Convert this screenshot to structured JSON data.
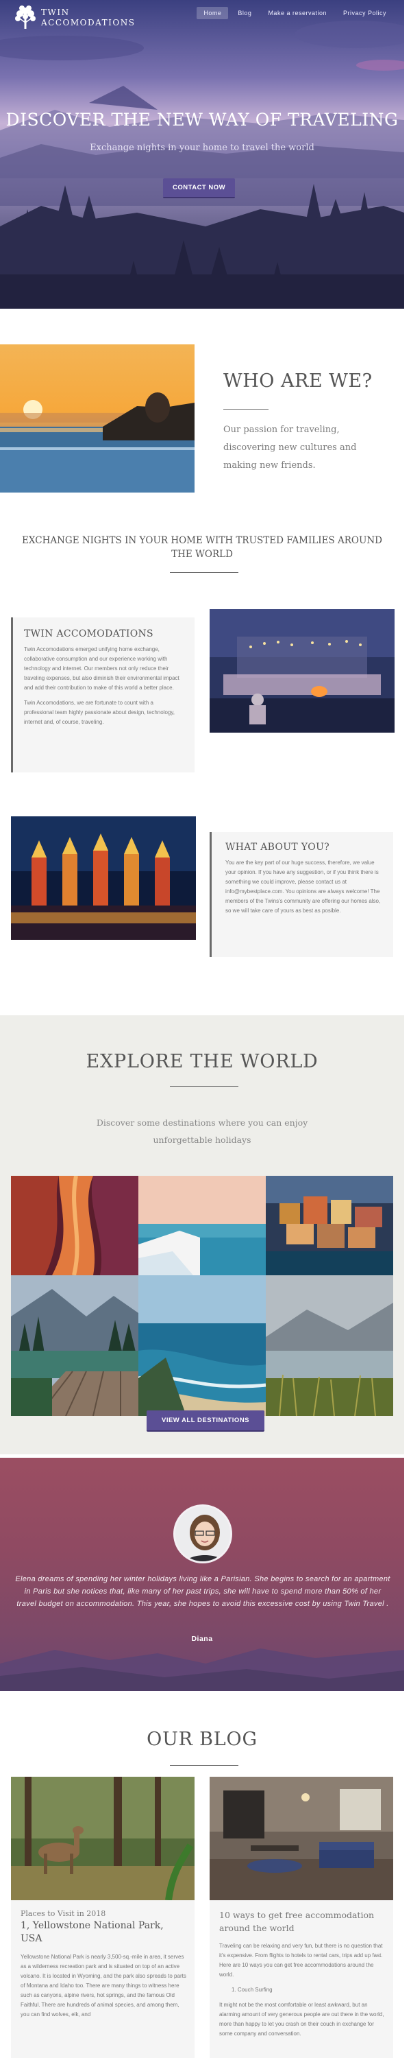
{
  "header": {
    "logo_line1": "TWIN",
    "logo_line2": "ACCOMODATIONS",
    "nav": [
      "Home",
      "Blog",
      "Make a reservation",
      "Privacy Policy"
    ]
  },
  "hero": {
    "title": "DISCOVER THE NEW WAY OF TRAVELING",
    "subtitle": "Exchange nights in your home to travel the world",
    "button": "CONTACT NOW"
  },
  "who": {
    "title": "WHO ARE WE?",
    "text": "Our passion for traveling, discovering new cultures and making new friends."
  },
  "exchange": {
    "title": "EXCHANGE NIGHTS IN YOUR HOME WITH TRUSTED FAMILIES AROUND THE WORLD"
  },
  "card1": {
    "title": "TWIN ACCOMODATIONS",
    "p1": "Twin Accomodations emerged unifying home exchange, collaborative consumption and our experience working with technology and internet. Our members not only reduce their traveling expenses, but also diminish their environmental impact and add their contribution to make of this world a better place.",
    "p2": "Twin Accomodations, we are fortunate to count with a professional team highly passionate about design, technology, internet and, of course, traveling."
  },
  "card2": {
    "title": "WHAT ABOUT YOU?",
    "p1": "You are the key part of our huge success, therefore, we value your opinion. If you have any suggestion, or if you think there is something we could improve, please contact us at info@mybestplace.com. You opinions are always welcome! The members of the Twins's community are offering our homes also, so we will take care of yours as best as posible."
  },
  "explore": {
    "title": "EXPLORE THE WORLD",
    "subtitle": "Discover some destinations where you can enjoy unforgettable holidays",
    "button": "VIEW ALL DESTINATIONS"
  },
  "testimonial": {
    "quote": "Elena dreams of spending her winter holidays living like a Parisian. She begins to search for an apartment in Paris but she notices that, like many of her past trips, she will have to spend more than 50% of her travel budget on accommodation. This year, she hopes to avoid this excessive cost by using Twin Travel .",
    "author": "Diana"
  },
  "blog": {
    "title": "OUR BLOG",
    "post1": {
      "title": "Places to Visit in 2018",
      "subtitle": "1, Yellowstone National Park, USA",
      "text": "Yellowstone National Park is nearly 3,500-sq.-mile in area, it serves as a wilderness recreation park and is situated on top of an active volcano. It is located in Wyoming, and the park also spreads to parts of Montana and Idaho too. There are many things to witness here such as canyons, alpine rivers, hot springs, and the famous Old Faithful. There are hundreds of animal species, and among them, you can find wolves, elk, and"
    },
    "post2": {
      "title": "10 ways to get free accommodation around the world",
      "p1": "Traveling can be relaxing and very fun, but there is no question that it's expensive. From flights to hotels to rental cars, trips add up fast. Here are 10 ways you can get free accommodations around the world.",
      "item1": "1. Couch Surfing",
      "p2": "It might not be the most comfortable or least awkward, but an alarming amount of very generous people are out there in the world, more than happy to let you crash on their couch in exchange for some company and conversation."
    }
  }
}
